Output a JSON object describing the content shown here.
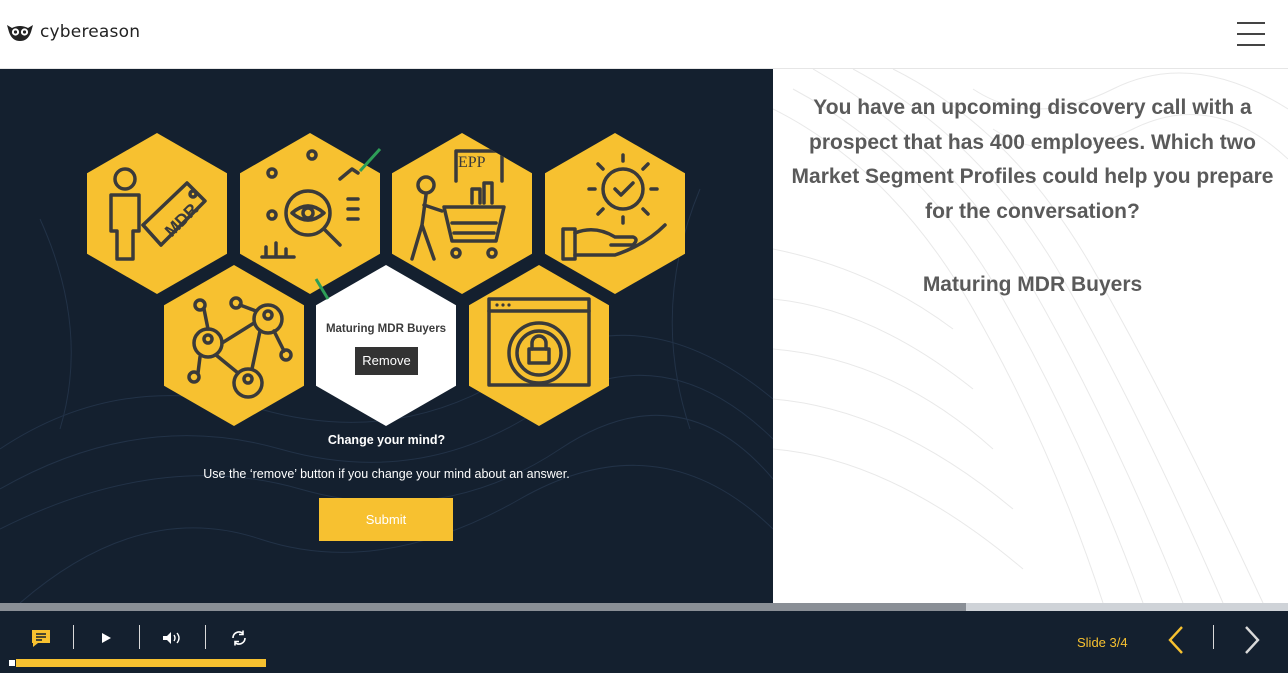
{
  "header": {
    "logo_text": "cybereason",
    "logo_icon": "owl-icon",
    "menu_icon": "hamburger-menu-icon"
  },
  "activity": {
    "hexes": [
      {
        "icon": "mdr-person-tag-icon"
      },
      {
        "icon": "eye-magnifier-analytics-icon"
      },
      {
        "icon": "epp-shopping-cart-icon"
      },
      {
        "icon": "gear-hand-check-icon"
      },
      {
        "icon": "network-people-icon"
      },
      {
        "icon": "selected-answer"
      },
      {
        "icon": "browser-lock-icon"
      }
    ],
    "selected_answer": "Maturing MDR Buyers",
    "remove_label": "Remove",
    "change_title": "Change your mind?",
    "change_text": "Use the ‘remove’ button if you change your mind about an answer.",
    "submit_label": "Submit",
    "epp_text": "EPP",
    "mdr_text": "MDR"
  },
  "question": {
    "text": "You have an upcoming discovery call with a prospect that has 400 employees. Which two Market Segment Profiles could help you prepare for the conversation?",
    "answer": "Maturing MDR Buyers"
  },
  "player": {
    "slide_label": "Slide 3/4",
    "progress": 0.2,
    "timeline_progress": 0.75,
    "accent_color": "#f7c130",
    "bg_color": "#14202f"
  }
}
